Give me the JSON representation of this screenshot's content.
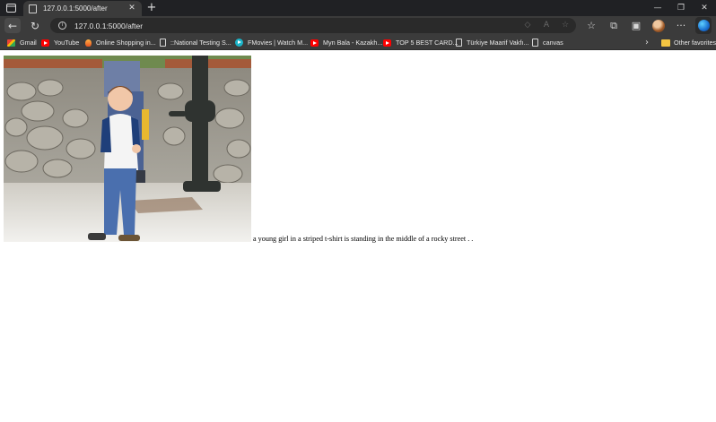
{
  "tab": {
    "title": "127.0.0.1:5000/after",
    "close_glyph": "✕",
    "new_tab_glyph": "+"
  },
  "window_controls": {
    "minimize": "—",
    "maximize": "❐",
    "close": "✕"
  },
  "toolbar": {
    "back_glyph": "←",
    "reload_glyph": "↻",
    "url": "127.0.0.1:5000/after",
    "info_glyph": "i"
  },
  "bookmarks": [
    {
      "label": "Gmail",
      "icon": "gmail-icon"
    },
    {
      "label": "YouTube",
      "icon": "youtube-icon"
    },
    {
      "label": "Online Shopping in...",
      "icon": "shopping-icon"
    },
    {
      "label": "::National Testing S...",
      "icon": "page-icon"
    },
    {
      "label": "FMovies | Watch M...",
      "icon": "fmovies-icon"
    },
    {
      "label": "Myn Bala - Kazakh...",
      "icon": "youtube-icon"
    },
    {
      "label": "TOP 5 BEST CARD...",
      "icon": "youtube-icon"
    },
    {
      "label": "Türkiye Maarif Vakfı...",
      "icon": "page-icon"
    },
    {
      "label": "canvas",
      "icon": "page-icon"
    }
  ],
  "other_favorites": "Other favorites",
  "page": {
    "caption": "a young girl in a striped t-shirt is standing in the middle of a rocky street . ."
  }
}
